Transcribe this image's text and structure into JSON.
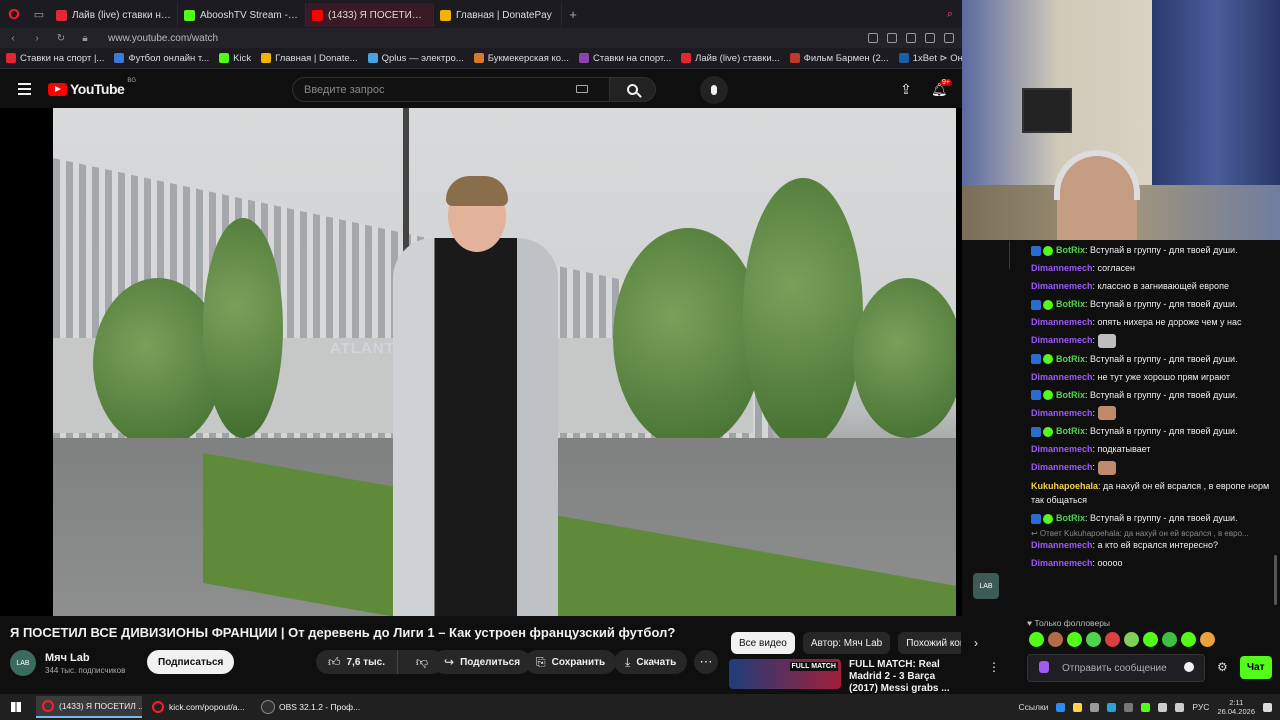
{
  "browser": {
    "tabs": [
      {
        "label": "Лайв (live) ставки на Бас",
        "color": "#e3262f",
        "active": false
      },
      {
        "label": "AbooshTV Stream - Watch",
        "color": "#53fc18",
        "active": false
      },
      {
        "label": "(1433) Я ПОСЕТИЛ ВС",
        "color": "#ff0000",
        "active": true
      },
      {
        "label": "Главная | DonatePay",
        "color": "#f2b200",
        "active": false
      }
    ],
    "url": "www.youtube.com/watch",
    "bookmarks": [
      {
        "label": "Ставки на спорт |...",
        "color": "#e3262f"
      },
      {
        "label": "Футбол онлайн т...",
        "color": "#3a7bd5"
      },
      {
        "label": "Kick",
        "color": "#53fc18"
      },
      {
        "label": "Главная | Donate...",
        "color": "#f2b200"
      },
      {
        "label": "Qplus — электро...",
        "color": "#4aa3df"
      },
      {
        "label": "Букмекерская ко...",
        "color": "#d97a2b"
      },
      {
        "label": "Ставки на спорт...",
        "color": "#8e44ad"
      },
      {
        "label": "Лайв (live) ставки...",
        "color": "#e3262f"
      },
      {
        "label": "Фильм Бармен (2...",
        "color": "#c0392b"
      },
      {
        "label": "1xBet ⊳ Онлайн с...",
        "color": "#1b5ea8"
      }
    ]
  },
  "youtube": {
    "logo_text": "YouTube",
    "region": "BG",
    "search_placeholder": "Введите запрос",
    "notifications": "9+",
    "video": {
      "sign_text": "ATLANT",
      "channel_badge": "LAB"
    },
    "title": "Я ПОСЕТИЛ ВСЕ ДИВИЗИОНЫ ФРАНЦИИ | От деревень до Лиги 1 – Как устроен французский футбол?",
    "channel": {
      "name": "Мяч Lab",
      "subscribers": "344 тыс. подписчиков",
      "avatar_text": "LAB"
    },
    "subscribe_label": "Подписаться",
    "likes": "7,6 тыс.",
    "share_label": "Поделиться",
    "save_label": "Сохранить",
    "download_label": "Скачать",
    "chips": [
      "Все видео",
      "Автор: Мяч Lab",
      "Похожий контент"
    ],
    "recommendation": {
      "thumb_text": "FULL MATCH",
      "title": "FULL MATCH: Real Madrid 2 - 3 Barça (2017) Messi grabs ..."
    }
  },
  "chat": {
    "messages": [
      {
        "user": "BotRix",
        "user_color": "#4fd44f",
        "badges": true,
        "text": ": Вступай в группу - для твоей души."
      },
      {
        "user": "Dimannemech",
        "user_color": "#9b59ff",
        "text": ": согласен"
      },
      {
        "user": "Dimannemech",
        "user_color": "#9b59ff",
        "text": ": классно в загнивающей европе"
      },
      {
        "user": "BotRix",
        "user_color": "#4fd44f",
        "badges": true,
        "text": ": Вступай в группу - для твоей души."
      },
      {
        "user": "Dimannemech",
        "user_color": "#9b59ff",
        "text": ": опять нихера не дороже чем у нас"
      },
      {
        "user": "Dimannemech",
        "user_color": "#9b59ff",
        "text": ":",
        "emote": "cat"
      },
      {
        "user": "BotRix",
        "user_color": "#4fd44f",
        "badges": true,
        "text": ": Вступай в группу - для твоей души."
      },
      {
        "user": "Dimannemech",
        "user_color": "#9b59ff",
        "text": ": не тут уже хорошо прям играют"
      },
      {
        "user": "BotRix",
        "user_color": "#4fd44f",
        "badges": true,
        "text": ": Вступай в группу - для твоей души."
      },
      {
        "user": "Dimannemech",
        "user_color": "#9b59ff",
        "text": ":",
        "emote": "face"
      },
      {
        "user": "BotRix",
        "user_color": "#4fd44f",
        "badges": true,
        "text": ": Вступай в группу - для твоей души."
      },
      {
        "user": "Dimannemech",
        "user_color": "#9b59ff",
        "text": ": подкатывает"
      },
      {
        "user": "Dimannemech",
        "user_color": "#9b59ff",
        "text": ":",
        "emote": "face"
      },
      {
        "user": "Kukuhapoehala",
        "user_color": "#f2d24b",
        "text": ": да нахуй он ей всрался , в европе норм так общаться"
      },
      {
        "user": "BotRix",
        "user_color": "#4fd44f",
        "badges": true,
        "text": ": Вступай в группу - для твоей души."
      }
    ],
    "reply_ref": "↩ Ответ Kukuhapoehala: да нахуй он ей всрался , в евро...",
    "after_reply": [
      {
        "user": "Dimannemech",
        "user_color": "#9b59ff",
        "text": ": а кто ей всрался интересно?"
      },
      {
        "user": "Dimannemech",
        "user_color": "#9b59ff",
        "text": ": ооооо"
      }
    ],
    "followers_only": "Только фолловеры",
    "input_placeholder": "Отправить сообщение",
    "send_label": "Чат"
  },
  "taskbar": {
    "tasks": [
      {
        "label": "(1433) Я ПОСЕТИЛ ...",
        "type": "opera",
        "active": true
      },
      {
        "label": "kick.com/popout/a...",
        "type": "opera",
        "active": false
      },
      {
        "label": "OBS 32.1.2 - Проф...",
        "type": "obs",
        "active": false
      }
    ],
    "links_label": "Ссылки",
    "lang": "РУС",
    "time": "2:11",
    "date": "26.04.2026"
  }
}
